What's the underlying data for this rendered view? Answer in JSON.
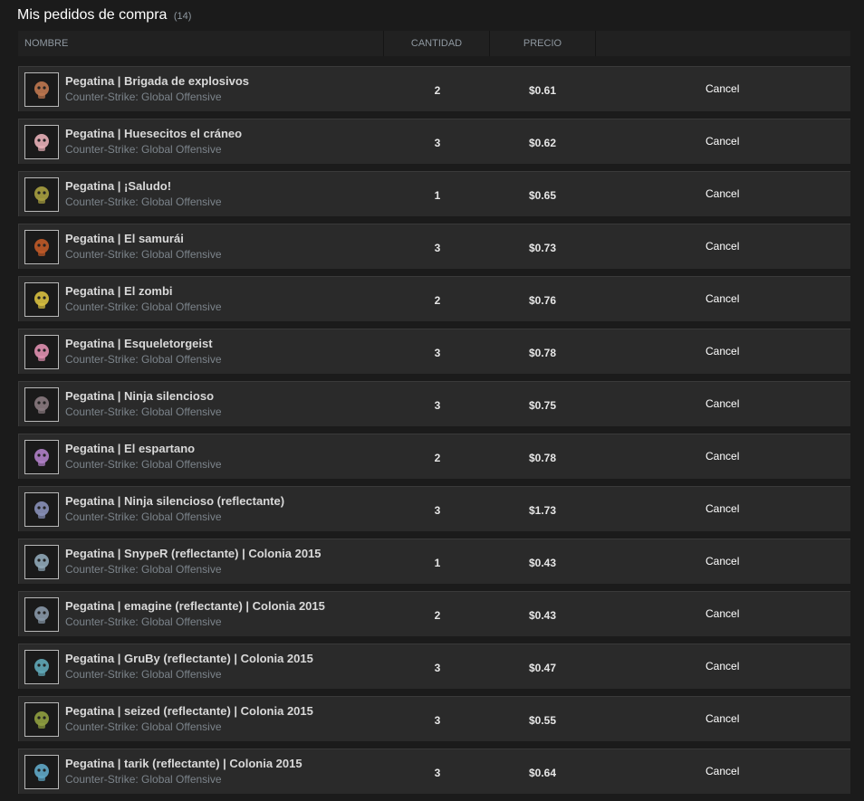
{
  "page": {
    "title": "Mis pedidos de compra",
    "count": "(14)"
  },
  "table": {
    "headers": {
      "name": "NOMBRE",
      "quantity": "CANTIDAD",
      "price": "PRECIO"
    },
    "rows": [
      {
        "name": "Pegatina | Brigada de explosivos",
        "game": "Counter-Strike: Global Offensive",
        "quantity": "2",
        "price": "$0.61",
        "action": "Cancel",
        "icon": "sticker-bomb-squad-icon",
        "icon_color": "#c07850"
      },
      {
        "name": "Pegatina | Huesecitos el cráneo",
        "game": "Counter-Strike: Global Offensive",
        "quantity": "3",
        "price": "$0.62",
        "action": "Cancel",
        "icon": "sticker-skull-icon",
        "icon_color": "#e8b0b8"
      },
      {
        "name": "Pegatina | ¡Saludo!",
        "game": "Counter-Strike: Global Offensive",
        "quantity": "1",
        "price": "$0.65",
        "action": "Cancel",
        "icon": "sticker-salute-icon",
        "icon_color": "#a8a040"
      },
      {
        "name": "Pegatina | El samurái",
        "game": "Counter-Strike: Global Offensive",
        "quantity": "3",
        "price": "$0.73",
        "action": "Cancel",
        "icon": "sticker-samurai-icon",
        "icon_color": "#c05a28"
      },
      {
        "name": "Pegatina | El zombi",
        "game": "Counter-Strike: Global Offensive",
        "quantity": "2",
        "price": "$0.76",
        "action": "Cancel",
        "icon": "sticker-zombie-icon",
        "icon_color": "#d8c040"
      },
      {
        "name": "Pegatina | Esqueletorgeist",
        "game": "Counter-Strike: Global Offensive",
        "quantity": "3",
        "price": "$0.78",
        "action": "Cancel",
        "icon": "sticker-skeleton-icon",
        "icon_color": "#e090b0"
      },
      {
        "name": "Pegatina | Ninja silencioso",
        "game": "Counter-Strike: Global Offensive",
        "quantity": "3",
        "price": "$0.75",
        "action": "Cancel",
        "icon": "sticker-ninja-icon",
        "icon_color": "#8a7a80"
      },
      {
        "name": "Pegatina | El espartano",
        "game": "Counter-Strike: Global Offensive",
        "quantity": "2",
        "price": "$0.78",
        "action": "Cancel",
        "icon": "sticker-spartan-icon",
        "icon_color": "#b080c8"
      },
      {
        "name": "Pegatina | Ninja silencioso (reflectante)",
        "game": "Counter-Strike: Global Offensive",
        "quantity": "3",
        "price": "$1.73",
        "action": "Cancel",
        "icon": "sticker-ninja-foil-icon",
        "icon_color": "#8890b8"
      },
      {
        "name": "Pegatina | SnypeR (reflectante) | Colonia 2015",
        "game": "Counter-Strike: Global Offensive",
        "quantity": "1",
        "price": "$0.43",
        "action": "Cancel",
        "icon": "sticker-snyper-icon",
        "icon_color": "#90a8b8"
      },
      {
        "name": "Pegatina | emagine (reflectante) | Colonia 2015",
        "game": "Counter-Strike: Global Offensive",
        "quantity": "2",
        "price": "$0.43",
        "action": "Cancel",
        "icon": "sticker-emagine-icon",
        "icon_color": "#8898a8"
      },
      {
        "name": "Pegatina | GruBy (reflectante) | Colonia 2015",
        "game": "Counter-Strike: Global Offensive",
        "quantity": "3",
        "price": "$0.47",
        "action": "Cancel",
        "icon": "sticker-gruby-icon",
        "icon_color": "#60a8b8"
      },
      {
        "name": "Pegatina | seized (reflectante) | Colonia 2015",
        "game": "Counter-Strike: Global Offensive",
        "quantity": "3",
        "price": "$0.55",
        "action": "Cancel",
        "icon": "sticker-seized-icon",
        "icon_color": "#90a040"
      },
      {
        "name": "Pegatina | tarik (reflectante) | Colonia 2015",
        "game": "Counter-Strike: Global Offensive",
        "quantity": "3",
        "price": "$0.64",
        "action": "Cancel",
        "icon": "sticker-tarik-icon",
        "icon_color": "#60a8c8"
      }
    ]
  }
}
